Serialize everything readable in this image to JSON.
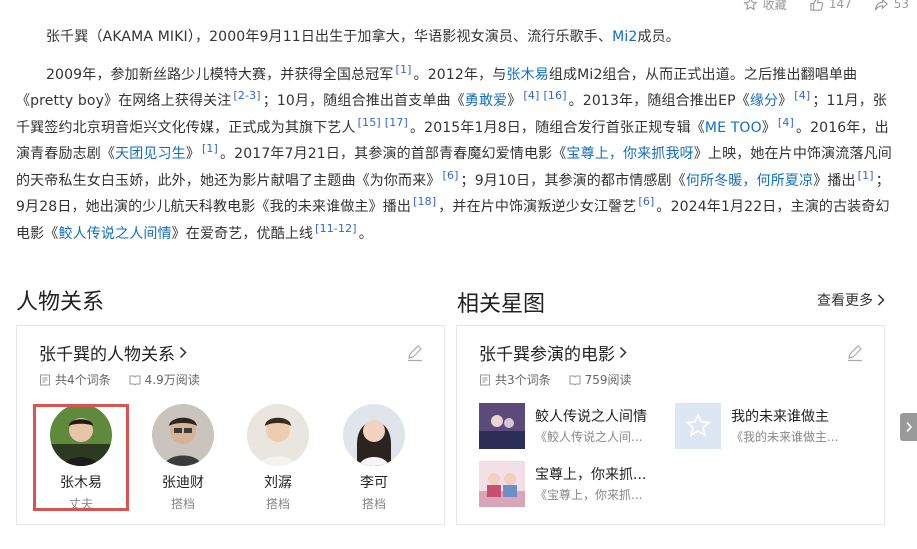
{
  "topbar": {
    "collect": "收藏",
    "like_count": "147",
    "share_count": "53"
  },
  "para1": {
    "p1": "张千巽（AKAMA MIKI），2000年9月11日出生于加拿大，华语影视女演员、流行乐歌手、",
    "l1": "Mi2",
    "p2": "成员。"
  },
  "para2": {
    "t1": "2009年，参加新丝路少儿模特大赛，并获得全国总冠军",
    "r1": "[1]",
    "t2": "。2012年，与",
    "l1": "张木易",
    "t3": "组成Mi2组合，从而正式出道。之后推出翻唱单曲《pretty boy》在网络上获得关注",
    "r2": "[2-3]",
    "t4": "；10月，随组合推出首支单曲《",
    "l2": "勇敢爱",
    "t5": "》",
    "r3": "[4]",
    "r4": "[16]",
    "t6": "。2013年，随组合推出EP《",
    "l3": "缘分",
    "t7": "》",
    "r5": "[4]",
    "t8": "；11月，张千巽签约北京玥音炬兴文化传媒，正式成为其旗下艺人",
    "r6": "[15]",
    "r7": "[17]",
    "t9": "。2015年1月8日，随组合发行首张正规专辑《",
    "l4": "ME TOO",
    "t10": "》",
    "r8": "[4]",
    "t11": "。2016年，出演青春励志剧《",
    "l5": "天团见习生",
    "t12": "》",
    "r9": "[1]",
    "t13": "。2017年7月21日，其参演的首部青春魔幻爱情电影《",
    "l6": "宝尊上，你来抓我呀",
    "t14": "》上映，她在片中饰演流落凡间的天帝私生女白玉娇，此外，她还为影片献唱了主题曲《为你而来》",
    "r10": "[6]",
    "t15": "；9月10日，其参演的都市情感剧《",
    "l7": "何所冬暖，何所夏凉",
    "t16": "》播出",
    "r11": "[1]",
    "t17": "；9月28日，她出演的少儿航天科教电影《我的未来谁做主》播出",
    "r12": "[18]",
    "t18": "，并在片中饰演叛逆少女江謦艺",
    "r13": "[6]",
    "t19": "。2024年1月22日，主演的古装奇幻电影《",
    "l8": "鲛人传说之人间情",
    "t20": "》在爱奇艺，优酷上线",
    "r14": "[11-12]",
    "t21": "。"
  },
  "relations": {
    "section_title": "人物关系",
    "card_title": "张千巽的人物关系",
    "entries": "共4个词条",
    "reads": "4.9万阅读",
    "people": [
      {
        "name": "张木易",
        "role": "丈夫"
      },
      {
        "name": "张迪财",
        "role": "搭档"
      },
      {
        "name": "刘潺",
        "role": "搭档"
      },
      {
        "name": "李可",
        "role": "搭档"
      }
    ]
  },
  "stars": {
    "section_title": "相关星图",
    "more": "查看更多",
    "card_title": "张千巽参演的电影",
    "entries": "共3个词条",
    "reads": "759阅读",
    "movies": [
      {
        "title": "鲛人传说之人间情",
        "sub": "《鲛人传说之人间..."
      },
      {
        "title": "我的未来谁做主",
        "sub": "《我的未来谁做主..."
      },
      {
        "title": "宝尊上，你来抓...",
        "sub": "《宝尊上，你来抓..."
      }
    ]
  },
  "colors": {
    "link": "#136ec2",
    "highlight_border": "#d9534f"
  },
  "icons": [
    "star-icon",
    "thumb-up-icon",
    "share-icon",
    "pencil-icon",
    "document-icon",
    "book-icon",
    "chevron-right-icon"
  ]
}
